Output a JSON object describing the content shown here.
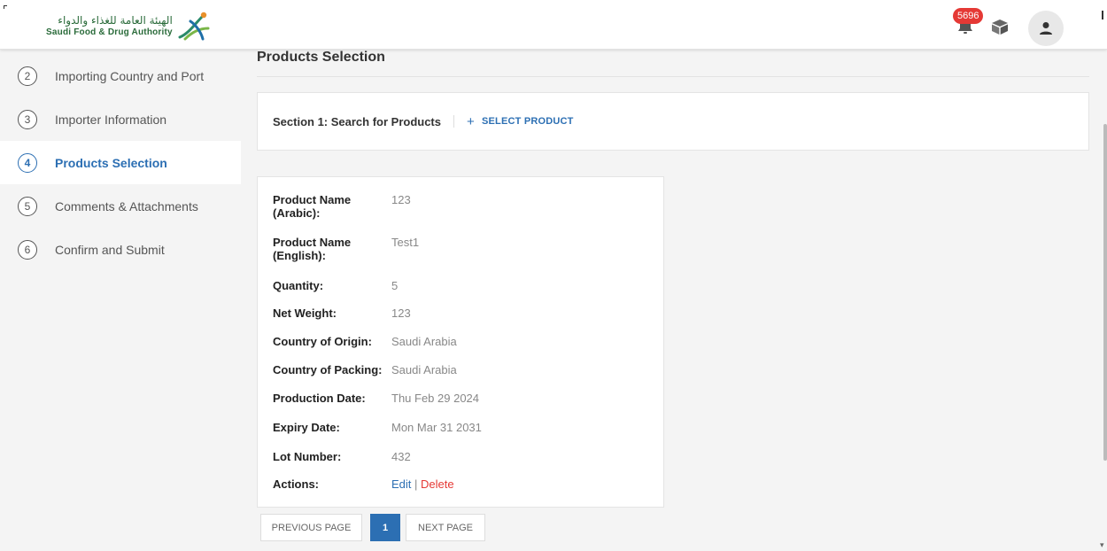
{
  "header": {
    "logo_arabic": "الهيئة العامة للغذاء والدواء",
    "logo_english": "Saudi Food & Drug Authority",
    "notification_count": "5696",
    "icons": [
      "bell-icon",
      "box-icon",
      "user-icon"
    ]
  },
  "sidebar": {
    "steps": [
      {
        "number": "2",
        "label": "Importing Country and Port",
        "active": false
      },
      {
        "number": "3",
        "label": "Importer Information",
        "active": false
      },
      {
        "number": "4",
        "label": "Products Selection",
        "active": true
      },
      {
        "number": "5",
        "label": "Comments & Attachments",
        "active": false
      },
      {
        "number": "6",
        "label": "Confirm and Submit",
        "active": false
      }
    ]
  },
  "main": {
    "title": "Products Selection",
    "section_label": "Section 1: Search for Products",
    "select_product_label": "SELECT PRODUCT",
    "product": {
      "name_arabic_label": "Product Name (Arabic):",
      "name_arabic_value": "123",
      "name_english_label": "Product Name (English):",
      "name_english_value": "Test1",
      "quantity_label": "Quantity:",
      "quantity_value": "5",
      "net_weight_label": "Net Weight:",
      "net_weight_value": "123",
      "origin_label": "Country of Origin:",
      "origin_value": "Saudi Arabia",
      "packing_label": "Country of Packing:",
      "packing_value": "Saudi Arabia",
      "production_label": "Production Date:",
      "production_value": "Thu Feb 29 2024",
      "expiry_label": "Expiry Date:",
      "expiry_value": "Mon Mar 31 2031",
      "lot_label": "Lot Number:",
      "lot_value": "432",
      "actions_label": "Actions:",
      "edit_label": "Edit",
      "action_separator": "|",
      "delete_label": "Delete"
    },
    "pagination": {
      "previous_label": "PREVIOUS PAGE",
      "current_page": "1",
      "next_label": "NEXT PAGE"
    }
  },
  "colors": {
    "accent": "#2c6fb3",
    "danger": "#e53935",
    "brand_green": "#2a6b3a"
  }
}
